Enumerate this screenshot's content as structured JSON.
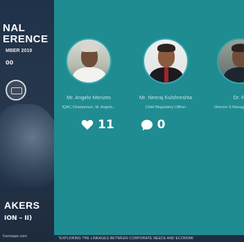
{
  "poster": {
    "title_line1": "NAL",
    "title_line2": "ERENCE",
    "date": "MBER 2019",
    "time": "00",
    "speakers_heading": "AKERS",
    "session": "ION – II)",
    "website": "fusneaps.com"
  },
  "speakers": [
    {
      "name": "Mr. Angelo Menzes",
      "role": "IQAC Chairperson, M. Angelo..."
    },
    {
      "name": "Mr. Neeraj Kulshreshta",
      "role": "Chief Regulatory Officer"
    },
    {
      "name": "Dr. R.",
      "role": "Director S Management Unive"
    }
  ],
  "stats": {
    "likes": "11",
    "comments": "0"
  },
  "ribbon": "\"EXPLORING THE LINKAGES BETWEEN CORPORATE NEEDS AND ECONOMI",
  "colors": {
    "teal_background": "#1f8c91",
    "poster_navy": "#203249"
  },
  "icons": {
    "like": "heart-icon",
    "comment": "speech-bubble-icon"
  }
}
